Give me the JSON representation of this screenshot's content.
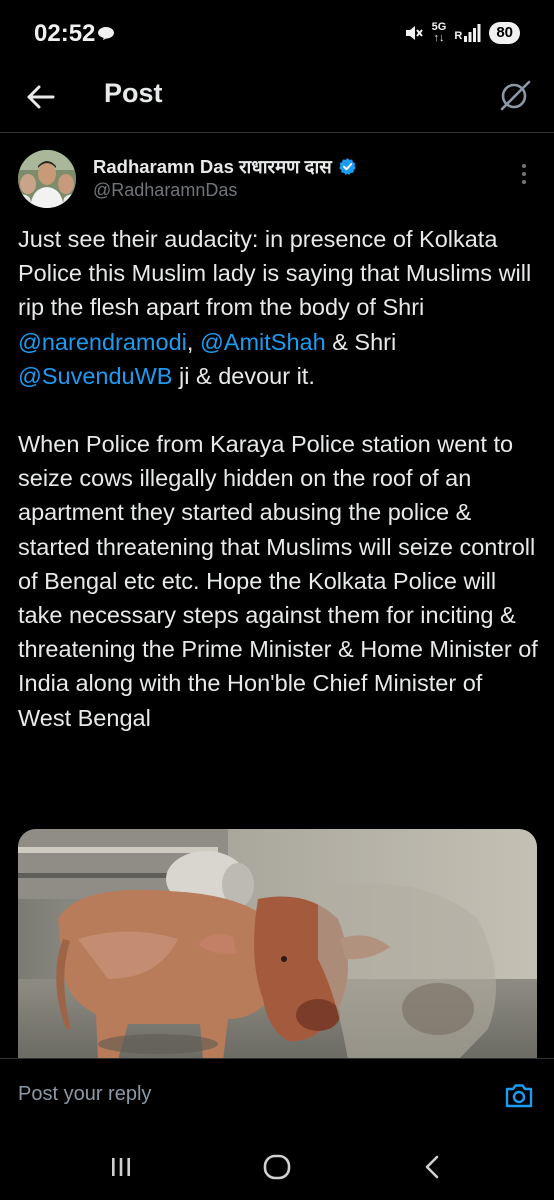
{
  "status_bar": {
    "time": "02:52",
    "network": "5G",
    "network_sub": "↑↓",
    "signal_label": "R",
    "battery": "80"
  },
  "header": {
    "title": "Post",
    "back_icon": "arrow-left-icon",
    "grok_icon": "grok-icon"
  },
  "post": {
    "display_name": "Radharamn Das राधारमण दास",
    "handle": "@RadharamnDas",
    "verified": true,
    "accent_color": "#1d9bf0",
    "paragraph1": [
      {
        "text": "Just see their audacity: in presence of Kolkata Police this Muslim  lady is saying that Muslims will rip the flesh apart from the body of Shri ",
        "mention": false
      },
      {
        "text": "@narendramodi",
        "mention": true
      },
      {
        "text": ", ",
        "mention": false
      },
      {
        "text": "@AmitShah",
        "mention": true
      },
      {
        "text": " & Shri ",
        "mention": false
      },
      {
        "text": "@SuvenduWB",
        "mention": true
      },
      {
        "text": " ji & devour it.",
        "mention": false
      }
    ],
    "paragraph2": "When Police from Karaya Police station went to seize cows illegally hidden on the roof of an apartment they started abusing the police & started threatening that Muslims will seize controll of Bengal etc etc. Hope the Kolkata Police will take necessary steps against them for inciting & threatening the Prime Minister & Home Minister of India along with the Hon'ble Chief Minister of West Bengal"
  },
  "reply_bar": {
    "placeholder": "Post your reply",
    "camera_icon": "camera-icon"
  },
  "nav_bar": {
    "recents_icon": "recents-icon",
    "home_icon": "home-circle-icon",
    "back_icon": "nav-back-icon"
  }
}
